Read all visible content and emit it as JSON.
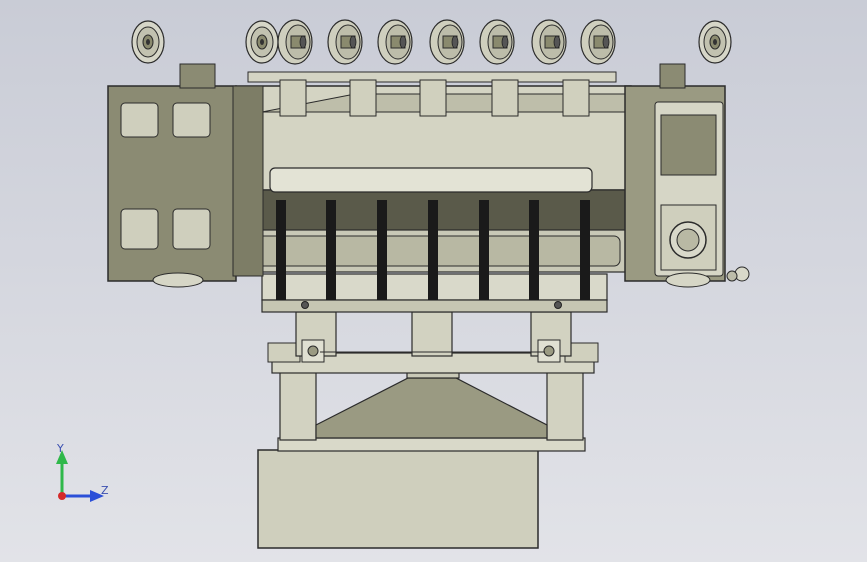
{
  "viewport": {
    "colors": {
      "background_top": "#c9ccd6",
      "background_bottom": "#e2e3e8",
      "body": "#cfcfbd",
      "body_dark": "#8a8a6e",
      "outline": "#2b2b2b",
      "blade": "#1a1a1a",
      "plate": "#8b8b73"
    }
  },
  "triad": {
    "y_label": "Y",
    "z_label": "Z",
    "colors": {
      "y": "#2fb84a",
      "z": "#2b4fd8",
      "x": "#d42a2a"
    }
  }
}
